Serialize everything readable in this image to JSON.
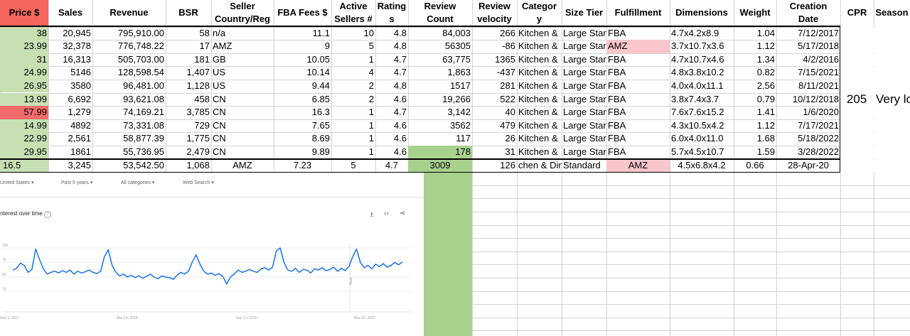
{
  "headers": [
    {
      "key": "price",
      "text": "Price $"
    },
    {
      "key": "sales",
      "text": "Sales"
    },
    {
      "key": "revenue",
      "text": "Revenue"
    },
    {
      "key": "bsr",
      "text": "BSR"
    },
    {
      "key": "seller",
      "text": "Seller\nCountry/Reg"
    },
    {
      "key": "fba",
      "text": "FBA Fees $"
    },
    {
      "key": "sellers",
      "text": "Active\nSellers #"
    },
    {
      "key": "rating",
      "text": "Rating\ns"
    },
    {
      "key": "review_count",
      "text": "Review\nCount"
    },
    {
      "key": "velocity",
      "text": "Review\nvelocity"
    },
    {
      "key": "category",
      "text": "Categor\ny"
    },
    {
      "key": "size",
      "text": "Size Tier"
    },
    {
      "key": "fulfillment",
      "text": "Fulfillment"
    },
    {
      "key": "dimensions",
      "text": "Dimensions"
    },
    {
      "key": "weight",
      "text": "Weight"
    },
    {
      "key": "created",
      "text": "Creation\nDate"
    },
    {
      "key": "cpr",
      "text": "CPR"
    },
    {
      "key": "season",
      "text": "Season"
    }
  ],
  "rows": [
    [
      "38",
      "20,945",
      "795,910.00",
      "58",
      "n/a",
      "11.1",
      "10",
      "4.8",
      "84,003",
      "266",
      "Kitchen &",
      "Large Star",
      "FBA",
      "4.7x4.2x8.9",
      "1.04",
      "7/12/2017"
    ],
    [
      "23.99",
      "32,378",
      "776,748.22",
      "17",
      "AMZ",
      "9",
      "5",
      "4.8",
      "56305",
      "-86",
      "Kitchen &",
      "Large Star",
      "AMZ",
      "3.7x10.7x3.6",
      "1.12",
      "5/17/2018"
    ],
    [
      "31",
      "16,313",
      "505,703.00",
      "181",
      "GB",
      "10.05",
      "1",
      "4.7",
      "63,775",
      "1365",
      "Kitchen &",
      "Large Star",
      "FBA",
      "4.7x10.7x4.6",
      "1.34",
      "4/2/2016"
    ],
    [
      "24.99",
      "5146",
      "128,598.54",
      "1,407",
      "US",
      "10.14",
      "4",
      "4.7",
      "1,863",
      "-437",
      "Kitchen &",
      "Large Star",
      "FBA",
      "4.8x3.8x10.2",
      "0.82",
      "7/15/2021"
    ],
    [
      "26.95",
      "3580",
      "96,481.00",
      "1,128",
      "US",
      "9.44",
      "2",
      "4.8",
      "1517",
      "281",
      "Kitchen &",
      "Large Star",
      "FBA",
      "4.0x4.0x11.1",
      "2.56",
      "8/11/2021"
    ],
    [
      "13.99",
      "6,692",
      "93,621.08",
      "458",
      "CN",
      "6.85",
      "2",
      "4.6",
      "19,266",
      "522",
      "Kitchen &",
      "Large Star",
      "FBA",
      "3.8x7.4x3.7",
      "0.79",
      "10/12/2018"
    ],
    [
      "57.99",
      "1,279",
      "74,169.21",
      "3,785",
      "CN",
      "16.3",
      "1",
      "4.7",
      "3,142",
      "40",
      "Kitchen &",
      "Large Star",
      "FBA",
      "7.6x7.6x15.2",
      "1.41",
      "1/6/2020"
    ],
    [
      "14.99",
      "4892",
      "73,331.08",
      "729",
      "CN",
      "7.65",
      "1",
      "4.6",
      "3562",
      "479",
      "Kitchen &",
      "Large Star",
      "FBA",
      "4.3x10.5x4.2",
      "1.12",
      "7/17/2021"
    ],
    [
      "22.99",
      "2,561",
      "58,877.39",
      "1,775",
      "CN",
      "8.69",
      "1",
      "4.6",
      "117",
      "26",
      "Kitchen &",
      "Large Star",
      "FBA",
      "6.0x4.0x11.0",
      "1.68",
      "5/18/2022"
    ],
    [
      "29.95",
      "1861",
      "55,736.95",
      "2,479",
      "CN",
      "9.89",
      "1",
      "4.6",
      "178",
      "31",
      "Kitchen &",
      "Large Star",
      "FBA",
      "5.7x4.5x10.7",
      "1.59",
      "3/28/2022"
    ]
  ],
  "avg_row": [
    "16.5",
    "3,245",
    "53,542.50",
    "1,068",
    "AMZ",
    "7.23",
    "5",
    "4.7",
    "3009",
    "126",
    "chen & Dine",
    "Standard",
    "AMZ",
    "4.5x6.8x4.2",
    "0.66",
    "28-Apr-20"
  ],
  "cpr_value": "205",
  "season_value": "Very lo",
  "colors": {
    "header_red": "#f4665f",
    "cell_red": "#f26b6b",
    "green": "#a9d18e",
    "light_green": "#c6e0b4",
    "pink": "#f8c6cb",
    "grid": "#d4d4d4",
    "trend_line": "#1a73e8"
  },
  "trends": {
    "filters": [
      "United States",
      "Past 5 years",
      "All categories",
      "Web Search"
    ],
    "title": "Interest over time",
    "y_ticks": [
      "100",
      "75",
      "50",
      "25"
    ],
    "x_ticks": [
      "Sep 3, 2017",
      "Mar 10, 2019",
      "Sep 13, 2020",
      "Mar 20, 2022"
    ],
    "note_label": "Note",
    "icons": [
      "download-icon",
      "embed-icon",
      "share-icon"
    ],
    "series": [
      62,
      65,
      74,
      70,
      58,
      63,
      98,
      80,
      64,
      55,
      58,
      60,
      57,
      61,
      58,
      62,
      55,
      60,
      57,
      59,
      62,
      58,
      56,
      60,
      85,
      97,
      70,
      58,
      52,
      55,
      50,
      53,
      49,
      52,
      48,
      51,
      55,
      50,
      47,
      52,
      50,
      49,
      46,
      53,
      58,
      55,
      60,
      76,
      88,
      72,
      60,
      55,
      57,
      53,
      56,
      51,
      38,
      50,
      55,
      62,
      58,
      60,
      63,
      60,
      58,
      64,
      66,
      62,
      67,
      95,
      100,
      75,
      62,
      60,
      65,
      58,
      63,
      62,
      57,
      64,
      62,
      66,
      61,
      63,
      67,
      60,
      65,
      61,
      68,
      85,
      98,
      75,
      66,
      70,
      64,
      72,
      68,
      73,
      67,
      70,
      75,
      71,
      76
    ]
  }
}
